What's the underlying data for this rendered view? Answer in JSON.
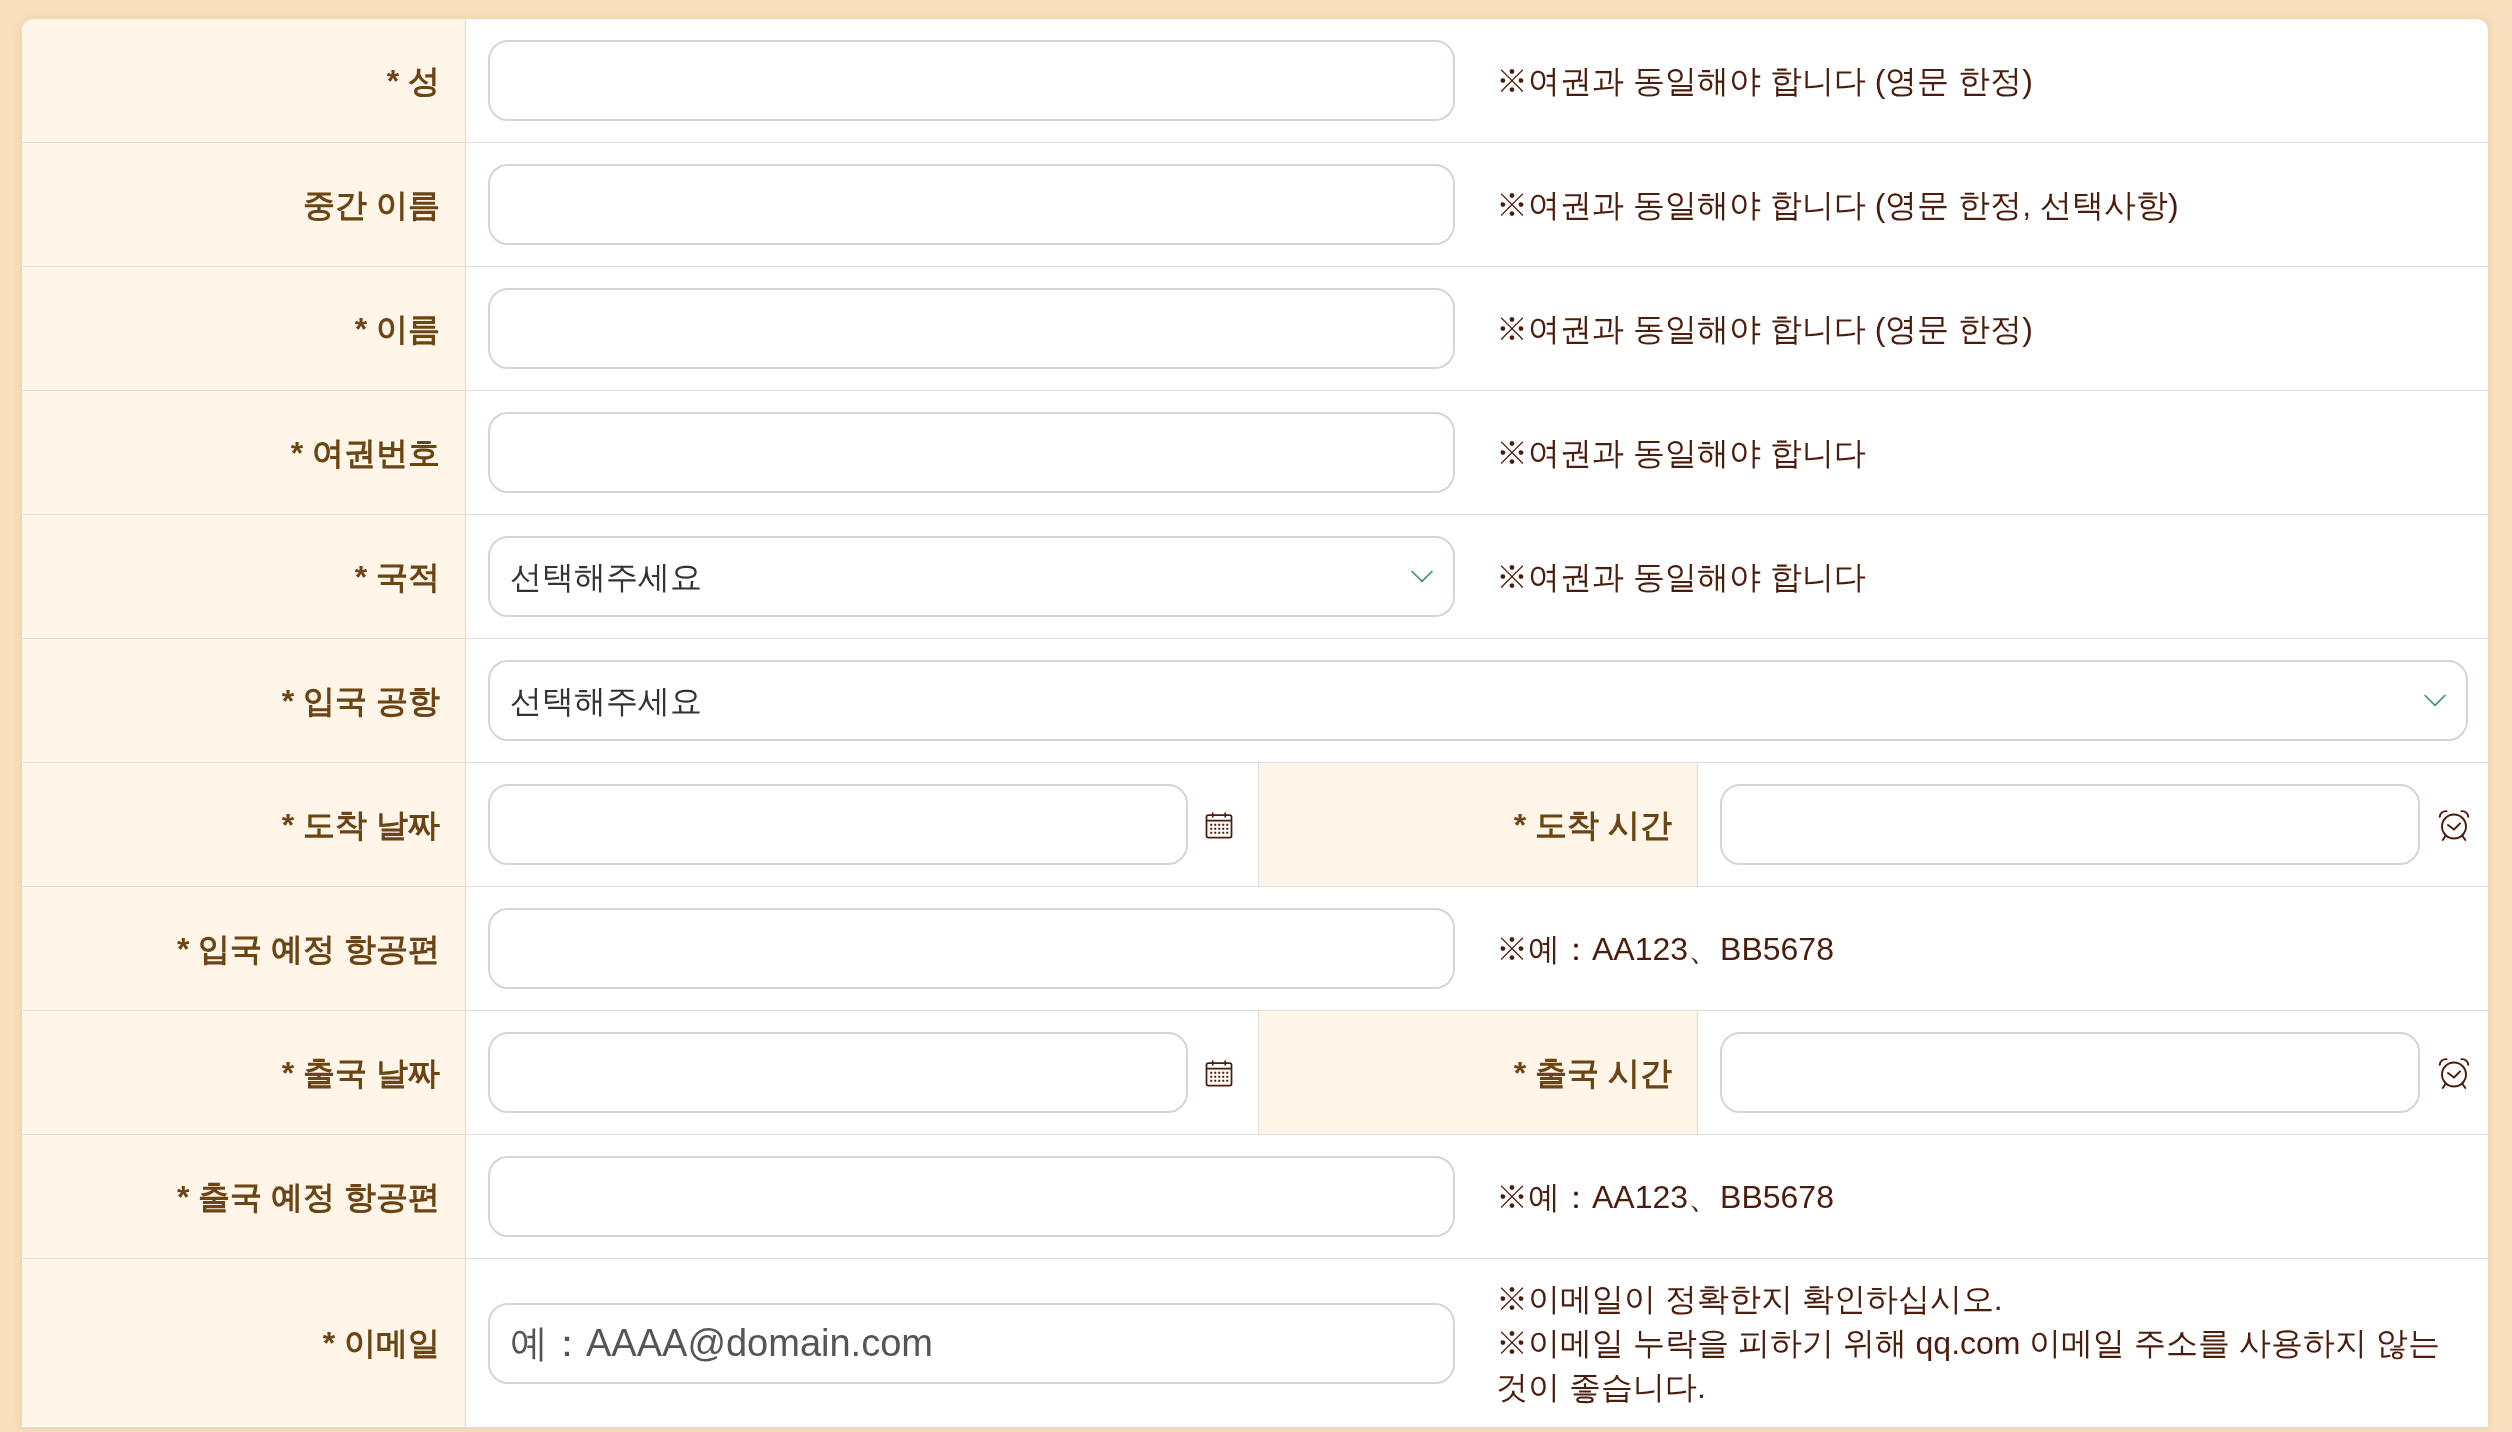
{
  "form": {
    "rows": [
      {
        "kind": "text",
        "label": "* 성",
        "notes": [
          "※여권과 동일해야 합니다 (영문 한정)"
        ]
      },
      {
        "kind": "text",
        "label": "중간 이름",
        "notes": [
          "※여권과 동일해야 합니다 (영문 한정, 선택사항)"
        ]
      },
      {
        "kind": "text",
        "label": "* 이름",
        "notes": [
          "※여권과 동일해야 합니다 (영문 한정)"
        ]
      },
      {
        "kind": "text",
        "label": "* 여권번호",
        "notes": [
          "※여권과 동일해야 합니다"
        ]
      },
      {
        "kind": "select",
        "label": "* 국적",
        "value": "선택해주세요",
        "notes": [
          "※여권과 동일해야 합니다"
        ]
      },
      {
        "kind": "select_wide",
        "label": "* 입국 공항",
        "value": "선택해주세요"
      },
      {
        "kind": "datetime",
        "label": "* 도착 날짜",
        "second_label": "* 도착 시간"
      },
      {
        "kind": "text",
        "label": "* 입국 예정 항공편",
        "notes": [
          "※예：AA123、BB5678"
        ]
      },
      {
        "kind": "datetime",
        "label": "* 출국 날짜",
        "second_label": "* 출국 시간"
      },
      {
        "kind": "text",
        "label": "* 출국 예정 항공편",
        "notes": [
          "※예：AA123、BB5678"
        ]
      },
      {
        "kind": "text",
        "label": "* 이메일",
        "placeholder": "예：AAAA@domain.com",
        "notes": [
          "※이메일이 정확한지 확인하십시오.",
          "※이메일 누락을 피하기 위해 qq.com 이메일 주소를 사용하지 않는 것이 좋습니다."
        ]
      }
    ]
  }
}
